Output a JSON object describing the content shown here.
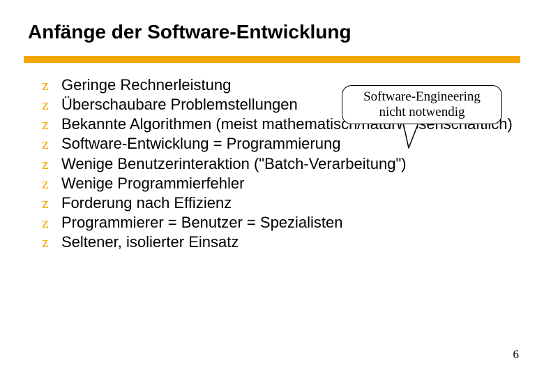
{
  "title": "Anfänge der Software-Entwicklung",
  "bullet_glyph": "z",
  "items": [
    "Geringe Rechnerleistung",
    "Überschaubare Problemstellungen",
    "Bekannte Algorithmen (meist mathematisch/naturwissenschaftlich)",
    "Software-Entwicklung = Programmierung",
    "Wenige Benutzerinteraktion (\"Batch-Verarbeitung\")",
    "Wenige Programmierfehler",
    "Forderung nach Effizienz",
    "Programmierer = Benutzer = Spezialisten",
    "Seltener, isolierter Einsatz"
  ],
  "callout": {
    "line1": "Software-Engineering",
    "line2": "nicht notwendig"
  },
  "page_number": "6",
  "colors": {
    "accent": "#f4a600"
  }
}
